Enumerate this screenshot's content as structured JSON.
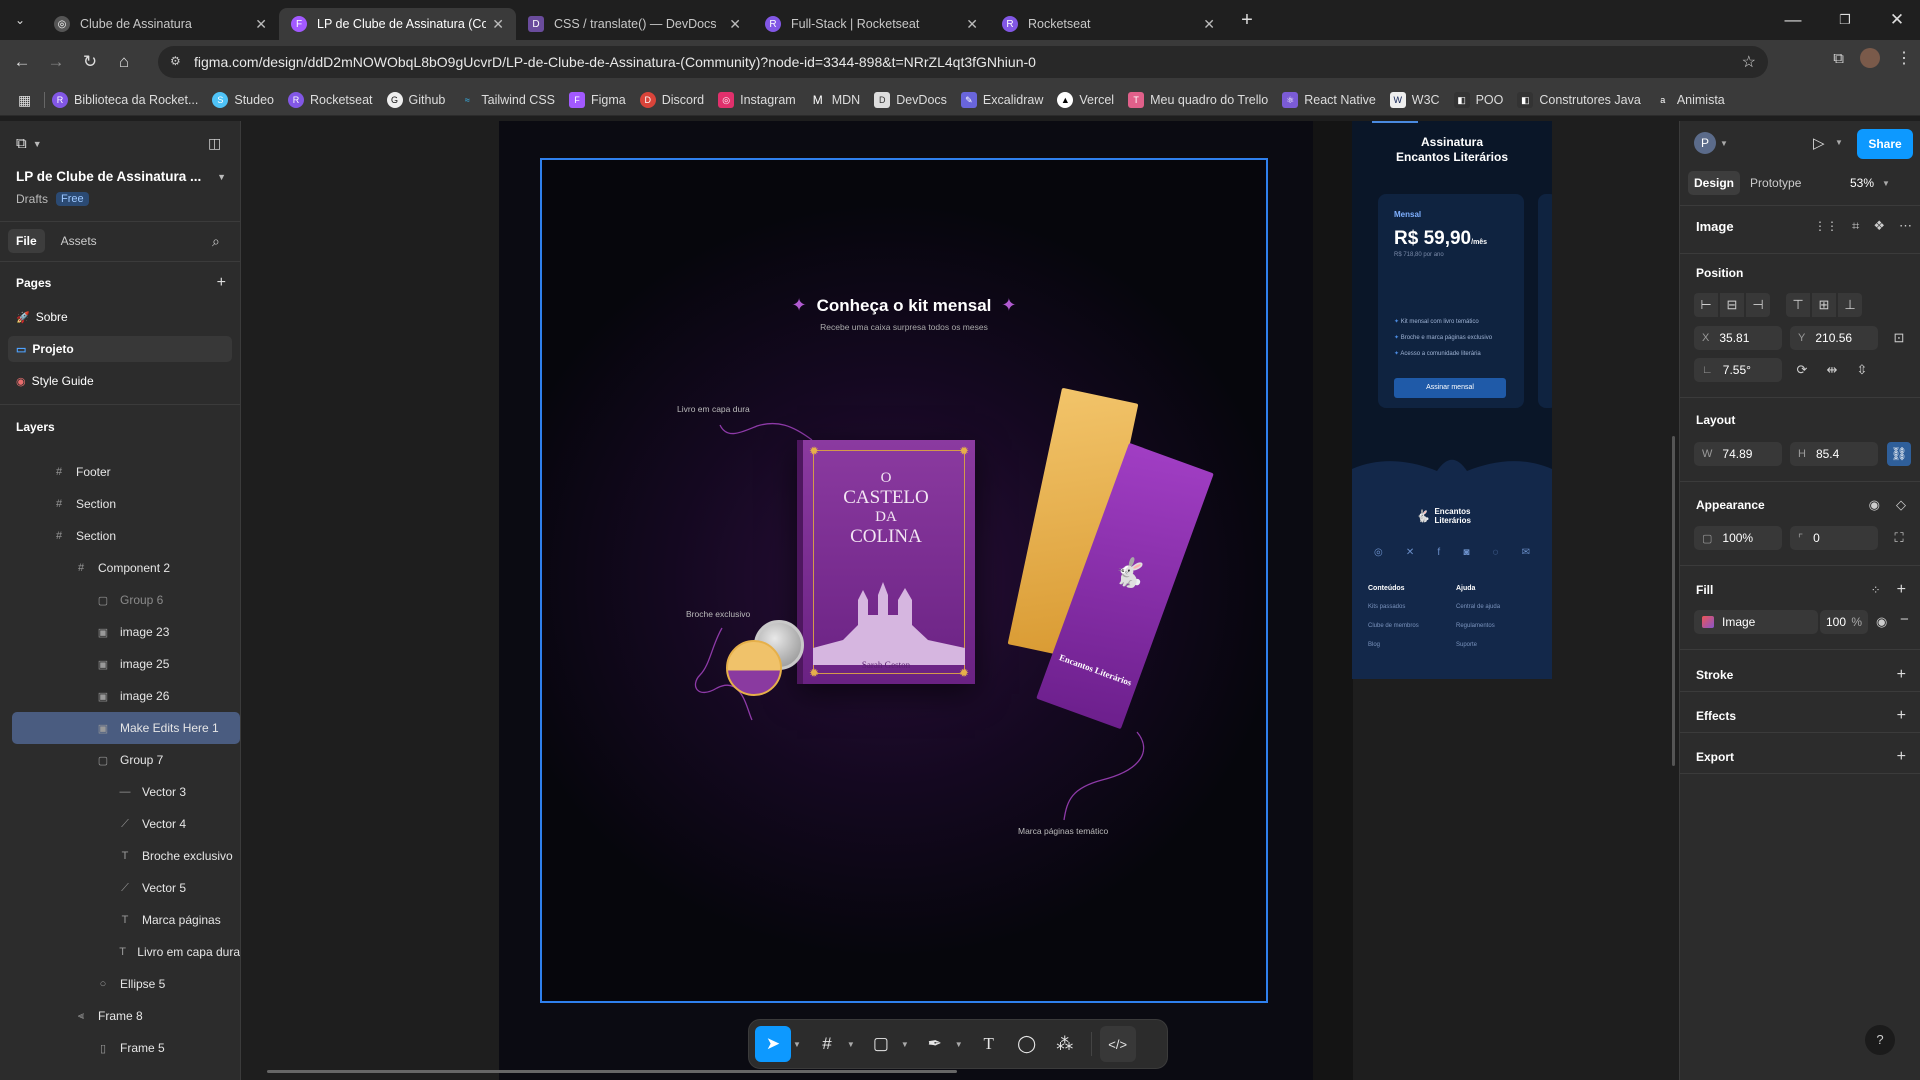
{
  "browser": {
    "tabs": [
      {
        "title": "Clube de Assinatura",
        "active": false
      },
      {
        "title": "LP de Clube de Assinatura (Com",
        "active": true
      },
      {
        "title": "CSS / translate() — DevDocs",
        "active": false
      },
      {
        "title": "Full-Stack | Rocketseat",
        "active": false
      },
      {
        "title": "Rocketseat",
        "active": false
      }
    ],
    "url": "figma.com/design/ddD2mNOWObqL8bO9gUcvrD/LP-de-Clube-de-Assinatura-(Community)?node-id=3344-898&t=NRrZL4qt3fGNhiun-0",
    "bookmarks": [
      "Biblioteca da Rocket...",
      "Studeo",
      "Rocketseat",
      "Github",
      "Tailwind CSS",
      "Figma",
      "Discord",
      "Instagram",
      "MDN",
      "DevDocs",
      "Excalidraw",
      "Vercel",
      "Meu quadro do Trello",
      "React Native",
      "W3C",
      "POO",
      "Construtores Java",
      "Animista"
    ]
  },
  "left_panel": {
    "file_title": "LP de Clube de Assinatura ...",
    "drafts": "Drafts",
    "plan_badge": "Free",
    "tab_file": "File",
    "tab_assets": "Assets",
    "pages_header": "Pages",
    "pages": [
      {
        "name": "Sobre",
        "active": false
      },
      {
        "name": "Projeto",
        "active": true
      },
      {
        "name": "Style Guide",
        "active": false
      }
    ],
    "layers_header": "Layers",
    "layers": [
      {
        "name": "Footer",
        "icon": "#",
        "depth": 0,
        "selected": false
      },
      {
        "name": "Section",
        "icon": "#",
        "depth": 0,
        "selected": false
      },
      {
        "name": "Section",
        "icon": "#",
        "depth": 0,
        "selected": false
      },
      {
        "name": "Component 2",
        "icon": "#",
        "depth": 1,
        "selected": false
      },
      {
        "name": "Group 6",
        "icon": "▢",
        "depth": 2,
        "selected": false,
        "dim": true
      },
      {
        "name": "image 23",
        "icon": "▣",
        "depth": 2,
        "selected": false
      },
      {
        "name": "image 25",
        "icon": "▣",
        "depth": 2,
        "selected": false
      },
      {
        "name": "image 26",
        "icon": "▣",
        "depth": 2,
        "selected": false
      },
      {
        "name": "Make Edits Here 1",
        "icon": "▣",
        "depth": 2,
        "selected": true
      },
      {
        "name": "Group 7",
        "icon": "▢",
        "depth": 2,
        "selected": false
      },
      {
        "name": "Vector 3",
        "icon": "—",
        "depth": 3,
        "selected": false
      },
      {
        "name": "Vector 4",
        "icon": "⟋",
        "depth": 3,
        "selected": false
      },
      {
        "name": "Broche exclusivo",
        "icon": "T",
        "depth": 3,
        "selected": false
      },
      {
        "name": "Vector 5",
        "icon": "⟋",
        "depth": 3,
        "selected": false
      },
      {
        "name": "Marca páginas",
        "icon": "T",
        "depth": 3,
        "selected": false
      },
      {
        "name": "Livro em capa dura",
        "icon": "T",
        "depth": 3,
        "selected": false
      },
      {
        "name": "Ellipse 5",
        "icon": "○",
        "depth": 2,
        "selected": false
      },
      {
        "name": "Frame 8",
        "icon": "⫷",
        "depth": 1,
        "selected": false
      },
      {
        "name": "Frame 5",
        "icon": "▯",
        "depth": 2,
        "selected": false
      }
    ]
  },
  "design": {
    "kit_title": "Conheça o kit mensal",
    "kit_subtitle": "Recebe uma caixa surpresa todos os meses",
    "label_book": "Livro em capa dura",
    "label_pin": "Broche exclusivo",
    "label_bookmark": "Marca páginas temático",
    "book_title_lines": [
      "O",
      "CASTELO",
      "DA",
      "COLINA"
    ],
    "book_author": "Sarah Geston",
    "bookmark_text": "Encantos Literários",
    "mobile": {
      "heading_line1": "Assinatura",
      "heading_line2": "Encantos Literários",
      "plan_name": "Mensal",
      "price": "R$ 59,90",
      "price_unit": "/mês",
      "price_note": "R$ 718,80 por ano",
      "features": [
        "Kit mensal com livro temático",
        "Broche e marca páginas exclusivo",
        "Acesso a comunidade literária"
      ],
      "cta": "Assinar mensal",
      "logo_text": "Encantos Literários",
      "footer_col1_title": "Conteúdos",
      "footer_col1": [
        "Kits passados",
        "Clube de membros",
        "Blog"
      ],
      "footer_col2_title": "Ajuda",
      "footer_col2": [
        "Central de ajuda",
        "Regulamentos",
        "Suporte"
      ]
    }
  },
  "right_panel": {
    "avatar_letter": "P",
    "share": "Share",
    "tab_design": "Design",
    "tab_prototype": "Prototype",
    "zoom": "53%",
    "node_type": "Image",
    "position_header": "Position",
    "x_label": "X",
    "x_value": "35.81",
    "y_label": "Y",
    "y_value": "210.56",
    "rotation": "7.55°",
    "layout_header": "Layout",
    "w_label": "W",
    "w_value": "74.89",
    "h_label": "H",
    "h_value": "85.4",
    "appearance_header": "Appearance",
    "opacity": "100%",
    "corner_radius": "0",
    "fill_header": "Fill",
    "fill_type": "Image",
    "fill_opacity": "100",
    "fill_percent": "%",
    "stroke_header": "Stroke",
    "effects_header": "Effects",
    "export_header": "Export"
  },
  "colors": {
    "accent": "#0d99ff",
    "selection": "#2f80ed",
    "purple": "#8b3aa0",
    "gold": "#e6b04a",
    "navy": "#0b1b33"
  }
}
